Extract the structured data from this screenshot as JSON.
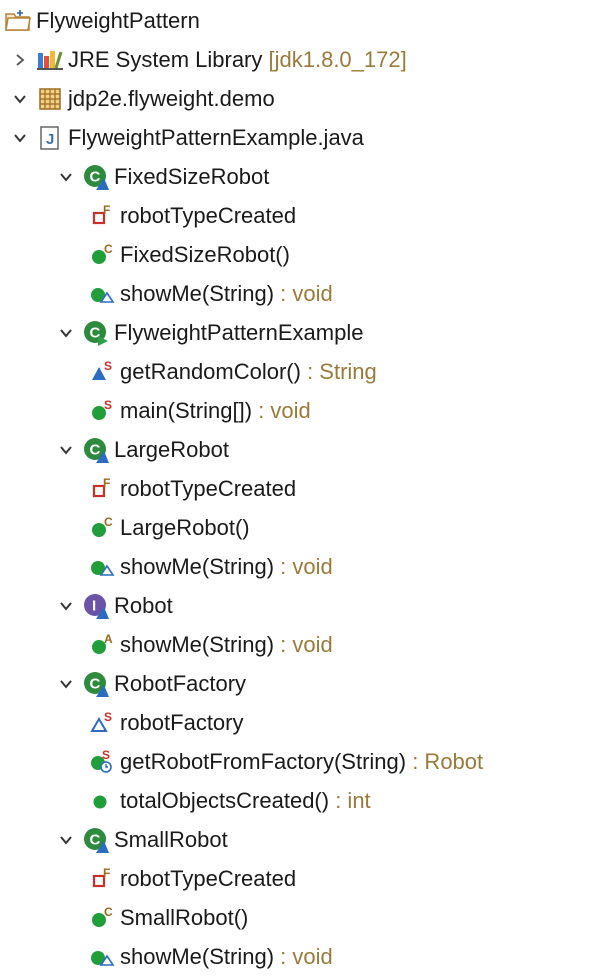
{
  "tree": [
    {
      "label": "FlyweightPattern",
      "suffix": "",
      "indent": 0,
      "chevron": "none",
      "icon": "project-folder-icon"
    },
    {
      "label": "JRE System Library",
      "suffix": " [jdk1.8.0_172]",
      "indent": 1,
      "chevron": "right",
      "icon": "library-books-icon"
    },
    {
      "label": "jdp2e.flyweight.demo",
      "suffix": "",
      "indent": 1,
      "chevron": "down",
      "icon": "package-icon"
    },
    {
      "label": "FlyweightPatternExample.java",
      "suffix": "",
      "indent": 2,
      "chevron": "down",
      "icon": "java-file-icon"
    },
    {
      "label": "FixedSizeRobot",
      "suffix": "",
      "indent": 3,
      "chevron": "down",
      "icon": "class-icon"
    },
    {
      "label": "robotTypeCreated",
      "suffix": "",
      "indent": 4,
      "chevron": "none",
      "icon": "final-field-icon"
    },
    {
      "label": "FixedSizeRobot()",
      "suffix": "",
      "indent": 4,
      "chevron": "none",
      "icon": "constructor-icon"
    },
    {
      "label": "showMe(String)",
      "suffix": " : void",
      "indent": 4,
      "chevron": "none",
      "icon": "override-method-icon"
    },
    {
      "label": "FlyweightPatternExample",
      "suffix": "",
      "indent": 3,
      "chevron": "down",
      "icon": "class-main-icon"
    },
    {
      "label": "getRandomColor()",
      "suffix": " : String",
      "indent": 4,
      "chevron": "none",
      "icon": "static-private-method-icon"
    },
    {
      "label": "main(String[])",
      "suffix": " : void",
      "indent": 4,
      "chevron": "none",
      "icon": "static-method-icon"
    },
    {
      "label": "LargeRobot",
      "suffix": "",
      "indent": 3,
      "chevron": "down",
      "icon": "class-icon"
    },
    {
      "label": "robotTypeCreated",
      "suffix": "",
      "indent": 4,
      "chevron": "none",
      "icon": "final-field-icon"
    },
    {
      "label": "LargeRobot()",
      "suffix": "",
      "indent": 4,
      "chevron": "none",
      "icon": "constructor-icon"
    },
    {
      "label": "showMe(String)",
      "suffix": " : void",
      "indent": 4,
      "chevron": "none",
      "icon": "override-method-icon"
    },
    {
      "label": "Robot",
      "suffix": "",
      "indent": 3,
      "chevron": "down",
      "icon": "interface-icon"
    },
    {
      "label": "showMe(String)",
      "suffix": " : void",
      "indent": 4,
      "chevron": "none",
      "icon": "abstract-method-icon"
    },
    {
      "label": "RobotFactory",
      "suffix": "",
      "indent": 3,
      "chevron": "down",
      "icon": "class-icon"
    },
    {
      "label": "robotFactory",
      "suffix": "",
      "indent": 4,
      "chevron": "none",
      "icon": "static-field-icon"
    },
    {
      "label": "getRobotFromFactory(String)",
      "suffix": " : Robot",
      "indent": 4,
      "chevron": "none",
      "icon": "static-synchronized-method-icon"
    },
    {
      "label": "totalObjectsCreated()",
      "suffix": " : int",
      "indent": 4,
      "chevron": "none",
      "icon": "public-method-icon"
    },
    {
      "label": "SmallRobot",
      "suffix": "",
      "indent": 3,
      "chevron": "down",
      "icon": "class-icon"
    },
    {
      "label": "robotTypeCreated",
      "suffix": "",
      "indent": 4,
      "chevron": "none",
      "icon": "final-field-icon"
    },
    {
      "label": "SmallRobot()",
      "suffix": "",
      "indent": 4,
      "chevron": "none",
      "icon": "constructor-icon"
    },
    {
      "label": "showMe(String)",
      "suffix": " : void",
      "indent": 4,
      "chevron": "none",
      "icon": "override-method-icon"
    }
  ],
  "colors": {
    "class_green": "#2e8b3e",
    "method_green": "#1f9e3a",
    "interface_purple": "#6b53a8",
    "static_red": "#c8312a",
    "decoration_gold": "#9a7a3a"
  }
}
